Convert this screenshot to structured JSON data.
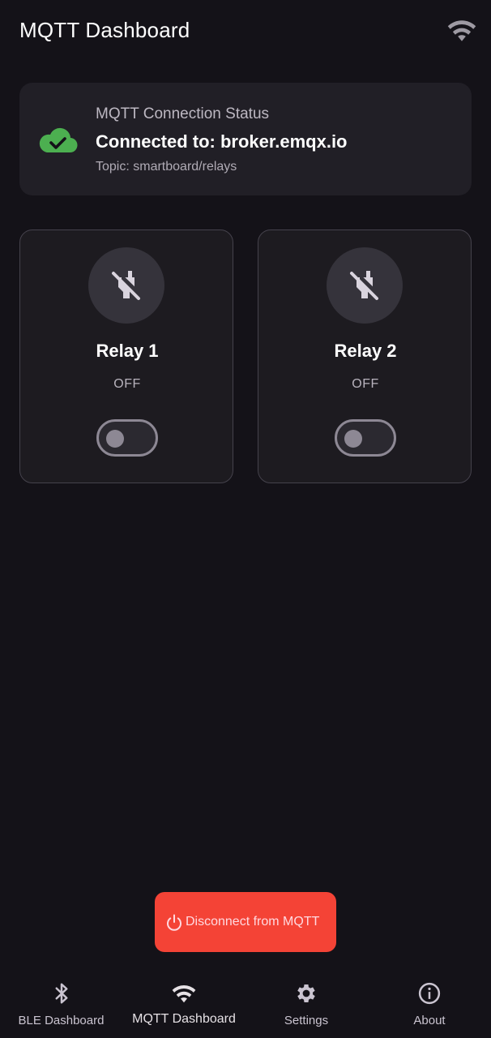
{
  "app_bar": {
    "title": "MQTT Dashboard",
    "status_icon": "wifi-icon"
  },
  "connection": {
    "heading": "MQTT Connection Status",
    "broker_text": "Connected to: broker.emqx.io",
    "topic_text": "Topic: smartboard/relays",
    "status_icon": "cloud-done-icon",
    "status_color": "#4caf50"
  },
  "relays": [
    {
      "name": "Relay 1",
      "state": "OFF",
      "on": false,
      "icon": "power-off-plug-icon"
    },
    {
      "name": "Relay 2",
      "state": "OFF",
      "on": false,
      "icon": "power-off-plug-icon"
    }
  ],
  "disconnect_button": {
    "label": "Disconnect from MQTT",
    "icon": "power-icon",
    "color": "#f44336"
  },
  "bottom_nav": {
    "items": [
      {
        "label": "BLE Dashboard",
        "icon": "bluetooth-icon",
        "active": false
      },
      {
        "label": "MQTT Dashboard",
        "icon": "wifi-icon",
        "active": true
      },
      {
        "label": "Settings",
        "icon": "gear-icon",
        "active": false
      },
      {
        "label": "About",
        "icon": "info-icon",
        "active": false
      }
    ]
  },
  "colors": {
    "background": "#141218",
    "card": "#211f26",
    "accent_success": "#4caf50",
    "danger": "#f44336"
  }
}
